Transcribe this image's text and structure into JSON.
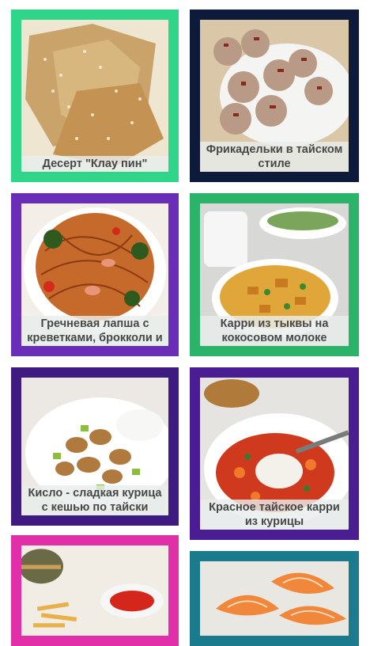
{
  "recipes": [
    {
      "title": "Десерт \"Клау пин\"",
      "border_color": "#2fd68a"
    },
    {
      "title": "Фрикадельки в тайском стиле",
      "border_color": "#0e1a3a"
    },
    {
      "title": "Гречневая лапша с креветками, брокколи и",
      "border_color": "#6a2db8"
    },
    {
      "title": "Карри из тыквы на кокосовом молоке",
      "border_color": "#2bb36a"
    },
    {
      "title": "Кисло - сладкая курица с кешью по тайски",
      "border_color": "#3d1b80"
    },
    {
      "title": "Красное тайское карри из курицы",
      "border_color": "#4a1d92"
    },
    {
      "title": "",
      "border_color": "#e02fa8"
    },
    {
      "title": "",
      "border_color": "#1b7a8c"
    }
  ]
}
